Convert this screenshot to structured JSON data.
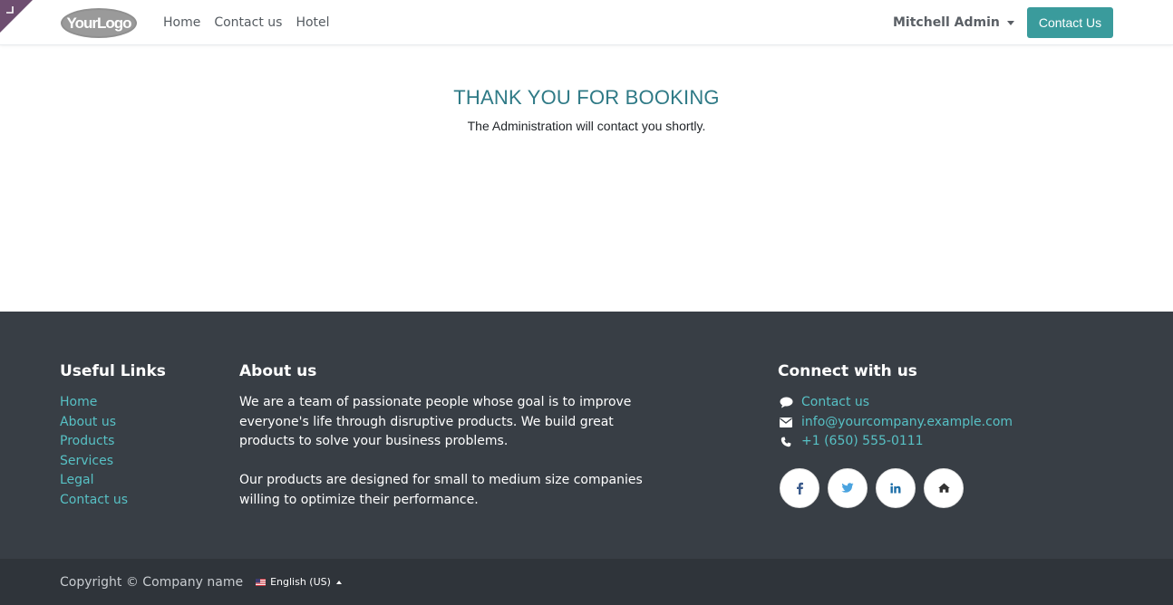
{
  "header": {
    "logo_text": "YourLogo",
    "nav": [
      "Home",
      "Contact us",
      "Hotel"
    ],
    "user_name": "Mitchell Admin",
    "cta_label": "Contact Us"
  },
  "main": {
    "title": "THANK YOU FOR BOOKING",
    "subtitle": "The Administration will contact you shortly."
  },
  "footer": {
    "useful_links": {
      "heading": "Useful Links",
      "links": [
        "Home",
        "About us",
        "Products",
        "Services",
        "Legal",
        "Contact us"
      ]
    },
    "about": {
      "heading": "About us",
      "paragraph1": "We are a team of passionate people whose goal is to improve everyone's life through disruptive products. We build great products to solve your business problems.",
      "paragraph2": "Our products are designed for small to medium size companies willing to optimize their performance."
    },
    "connect": {
      "heading": "Connect with us",
      "contact_label": "Contact us",
      "email": "info@yourcompany.example.com",
      "phone": "+1 (650) 555-0111",
      "socials": [
        "facebook-icon",
        "twitter-icon",
        "linkedin-icon",
        "home-icon"
      ]
    }
  },
  "copyright": {
    "text": "Copyright © Company name",
    "language": "English (US)"
  },
  "colors": {
    "accent": "#3a9b9c",
    "link": "#57c1c5",
    "title": "#2f7a86",
    "footer_bg": "#383e45",
    "copyright_bg": "#2f343a"
  }
}
